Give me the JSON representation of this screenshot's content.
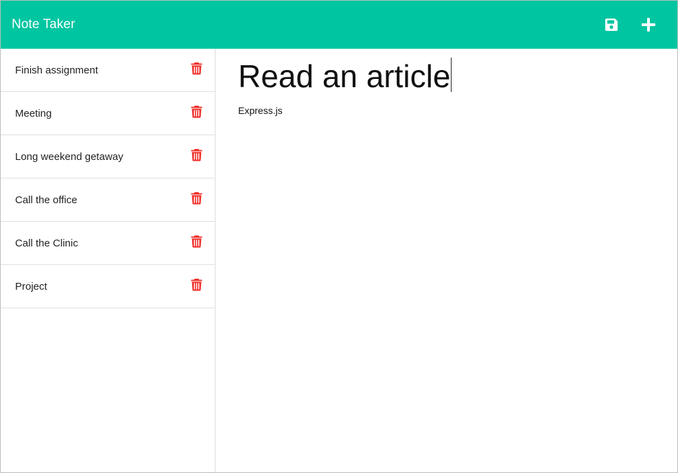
{
  "app": {
    "title": "Note Taker"
  },
  "navbar": {
    "save_icon": "save-icon",
    "add_icon": "plus-icon",
    "background": "#00c5a1"
  },
  "notes": [
    {
      "title": "Finish assignment"
    },
    {
      "title": "Meeting"
    },
    {
      "title": "Long weekend getaway"
    },
    {
      "title": "Call the office"
    },
    {
      "title": "Call the Clinic"
    },
    {
      "title": "Project"
    }
  ],
  "delete_icon": "trash-icon",
  "delete_color": "#f0302a",
  "editor": {
    "title_value": "Read an article",
    "body_value": "Express.js"
  }
}
